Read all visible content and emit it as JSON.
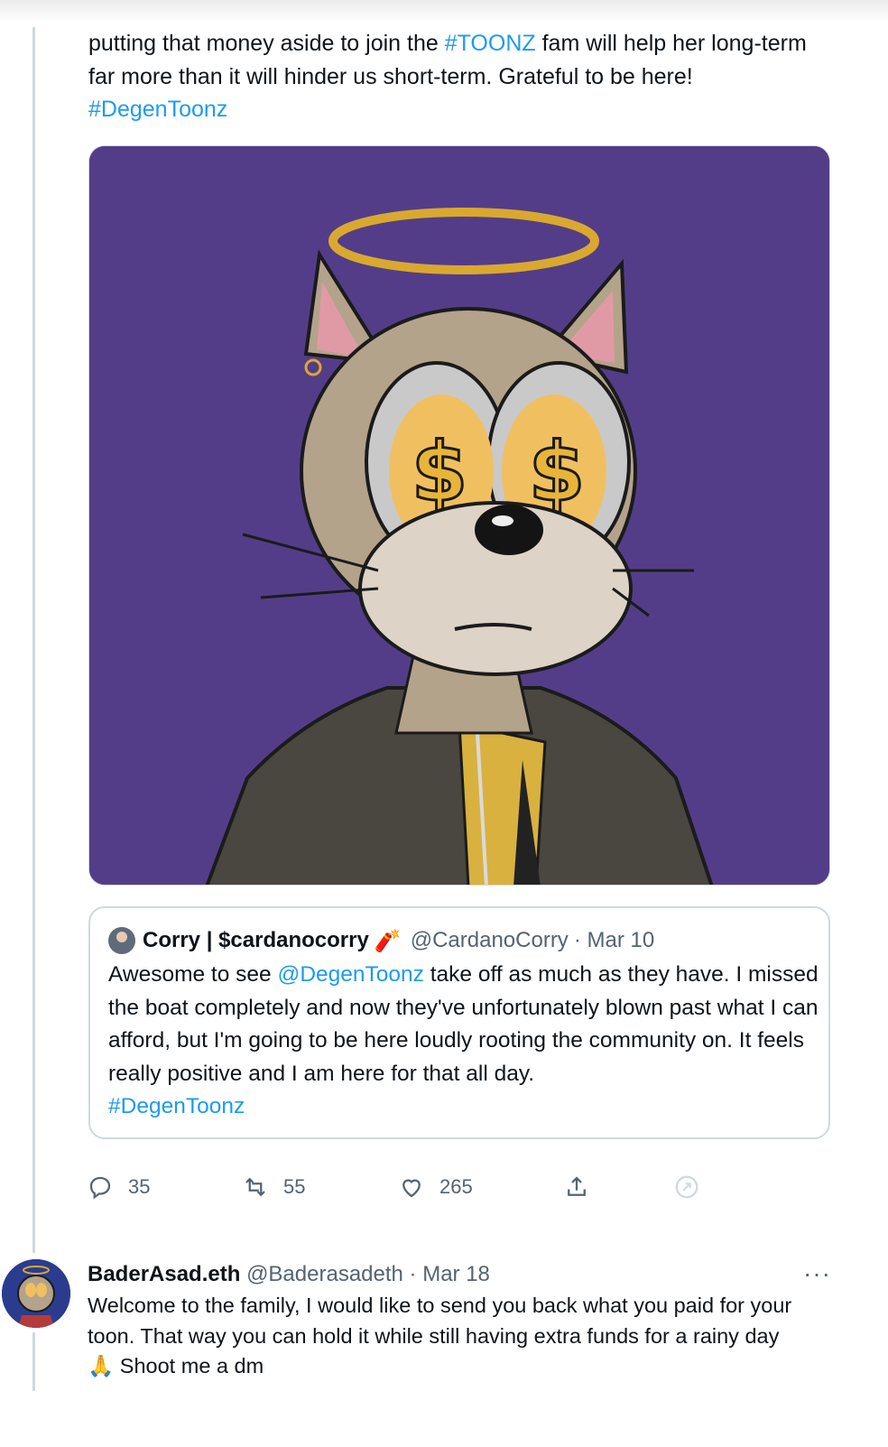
{
  "main_tweet": {
    "text_before_tag": "putting that money aside to join the ",
    "tag_toonz": "#TOONZ",
    "text_after_tag": " fam will help her long-term far more than it will hinder us short-term. Grateful to be here!",
    "tag_degentoonz": "#DegenToonz"
  },
  "quote": {
    "name": "Corry | $cardanocorry",
    "emoji": "🧨",
    "handle": "@CardanoCorry",
    "date": "· Mar 10",
    "text_before_mention": "Awesome to see ",
    "mention": "@DegenToonz",
    "text_after_mention": " take off as much as they have. I missed the boat completely and now they've unfortunately blown past what I can afford, but I'm going to be here loudly rooting the community on. It feels really positive and I am here for that all day.",
    "tag": "#DegenToonz"
  },
  "actions": {
    "replies": "35",
    "retweets": "55",
    "likes": "265"
  },
  "reply": {
    "name": "BaderAsad.eth",
    "handle": "@Baderasadeth",
    "date": "· Mar 18",
    "more": "···",
    "text": "Welcome to the family, I would like to send you back what you paid for your toon. That way you can hold it while still having extra funds for a rainy day",
    "emoji": "🙏",
    "text_end": "Shoot me a dm"
  },
  "colors": {
    "link": "#1d9bf0",
    "media_bg": "#543d88",
    "muted": "#536471"
  }
}
